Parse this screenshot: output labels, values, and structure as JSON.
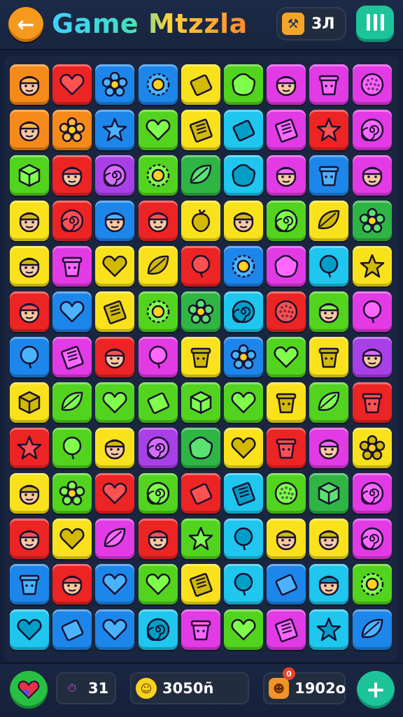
{
  "header": {
    "back_icon": "arrow-left-icon",
    "title": "Game Mtzzla",
    "score_icon": "wrench-badge-icon",
    "score_value": "3Л",
    "pause_icon": "pause-icon"
  },
  "footer": {
    "hint_icon": "heart-gem-icon",
    "moves_icon": "timer-icon",
    "moves_value": "31",
    "coins_icon": "smiley-coin-icon",
    "coins_value": "3050ñ",
    "bonus_icon": "face-badge-icon",
    "bonus_badge": "0",
    "bonus_value": "1902o",
    "add_icon": "plus-icon"
  },
  "colors": {
    "O": "#f58a1a",
    "R": "#ec2424",
    "B": "#1d86ea",
    "Y": "#f9e21c",
    "G": "#52d41e",
    "P": "#e23ae4",
    "C": "#1fc6ee",
    "DG": "#2fb544",
    "V": "#a93fe6"
  },
  "board": {
    "rows": 13,
    "cols": 9,
    "tiles": [
      [
        [
          "O",
          "face"
        ],
        [
          "R",
          "heart"
        ],
        [
          "B",
          "flower"
        ],
        [
          "B",
          "sun"
        ],
        [
          "Y",
          "block"
        ],
        [
          "G",
          "blob"
        ],
        [
          "P",
          "face"
        ],
        [
          "P",
          "bucket"
        ],
        [
          "P",
          "ball"
        ]
      ],
      [
        [
          "O",
          "face"
        ],
        [
          "O",
          "flower"
        ],
        [
          "B",
          "star"
        ],
        [
          "G",
          "heart"
        ],
        [
          "Y",
          "book"
        ],
        [
          "C",
          "block"
        ],
        [
          "P",
          "book"
        ],
        [
          "R",
          "star"
        ],
        [
          "P",
          "swirl"
        ]
      ],
      [
        [
          "G",
          "cube"
        ],
        [
          "R",
          "face"
        ],
        [
          "V",
          "swirl"
        ],
        [
          "G",
          "sun"
        ],
        [
          "DG",
          "leaf"
        ],
        [
          "C",
          "blob"
        ],
        [
          "P",
          "face"
        ],
        [
          "B",
          "bucket"
        ],
        [
          "P",
          "face"
        ]
      ],
      [
        [
          "Y",
          "face"
        ],
        [
          "R",
          "swirl"
        ],
        [
          "B",
          "face"
        ],
        [
          "R",
          "face"
        ],
        [
          "Y",
          "fruit"
        ],
        [
          "Y",
          "face"
        ],
        [
          "G",
          "swirl"
        ],
        [
          "Y",
          "leaf"
        ],
        [
          "DG",
          "flower"
        ]
      ],
      [
        [
          "Y",
          "face"
        ],
        [
          "P",
          "bucket"
        ],
        [
          "Y",
          "heart"
        ],
        [
          "Y",
          "leaf"
        ],
        [
          "R",
          "balloon"
        ],
        [
          "B",
          "sun"
        ],
        [
          "P",
          "blob"
        ],
        [
          "C",
          "balloon"
        ],
        [
          "Y",
          "star"
        ]
      ],
      [
        [
          "R",
          "face"
        ],
        [
          "B",
          "heart"
        ],
        [
          "Y",
          "book"
        ],
        [
          "G",
          "sun"
        ],
        [
          "DG",
          "flower"
        ],
        [
          "C",
          "swirl"
        ],
        [
          "R",
          "ball"
        ],
        [
          "G",
          "face"
        ],
        [
          "P",
          "balloon"
        ]
      ],
      [
        [
          "B",
          "balloon"
        ],
        [
          "P",
          "book"
        ],
        [
          "R",
          "face"
        ],
        [
          "P",
          "balloon"
        ],
        [
          "Y",
          "bucket"
        ],
        [
          "B",
          "flower"
        ],
        [
          "G",
          "heart"
        ],
        [
          "Y",
          "bucket"
        ],
        [
          "V",
          "face"
        ]
      ],
      [
        [
          "Y",
          "cube"
        ],
        [
          "G",
          "leaf"
        ],
        [
          "G",
          "heart"
        ],
        [
          "G",
          "block"
        ],
        [
          "G",
          "cube"
        ],
        [
          "G",
          "heart"
        ],
        [
          "Y",
          "bucket"
        ],
        [
          "G",
          "leaf"
        ],
        [
          "R",
          "bucket"
        ]
      ],
      [
        [
          "R",
          "star"
        ],
        [
          "G",
          "balloon"
        ],
        [
          "Y",
          "face"
        ],
        [
          "V",
          "swirl"
        ],
        [
          "DG",
          "blob"
        ],
        [
          "Y",
          "heart"
        ],
        [
          "R",
          "bucket"
        ],
        [
          "P",
          "face"
        ],
        [
          "Y",
          "flower"
        ]
      ],
      [
        [
          "Y",
          "face"
        ],
        [
          "G",
          "flower"
        ],
        [
          "R",
          "heart"
        ],
        [
          "G",
          "swirl"
        ],
        [
          "R",
          "block"
        ],
        [
          "C",
          "book"
        ],
        [
          "G",
          "ball"
        ],
        [
          "DG",
          "cube"
        ],
        [
          "P",
          "swirl"
        ]
      ],
      [
        [
          "R",
          "face"
        ],
        [
          "Y",
          "heart"
        ],
        [
          "P",
          "leaf"
        ],
        [
          "R",
          "face"
        ],
        [
          "G",
          "star"
        ],
        [
          "C",
          "balloon"
        ],
        [
          "Y",
          "face"
        ],
        [
          "Y",
          "face"
        ],
        [
          "P",
          "swirl"
        ]
      ],
      [
        [
          "B",
          "bucket"
        ],
        [
          "R",
          "face"
        ],
        [
          "B",
          "heart"
        ],
        [
          "G",
          "heart"
        ],
        [
          "Y",
          "book"
        ],
        [
          "C",
          "balloon"
        ],
        [
          "B",
          "block"
        ],
        [
          "C",
          "face"
        ],
        [
          "G",
          "sun"
        ]
      ],
      [
        [
          "C",
          "heart"
        ],
        [
          "B",
          "block"
        ],
        [
          "B",
          "heart"
        ],
        [
          "C",
          "swirl"
        ],
        [
          "P",
          "bucket"
        ],
        [
          "G",
          "heart"
        ],
        [
          "P",
          "book"
        ],
        [
          "C",
          "star"
        ],
        [
          "B",
          "leaf"
        ]
      ]
    ]
  }
}
